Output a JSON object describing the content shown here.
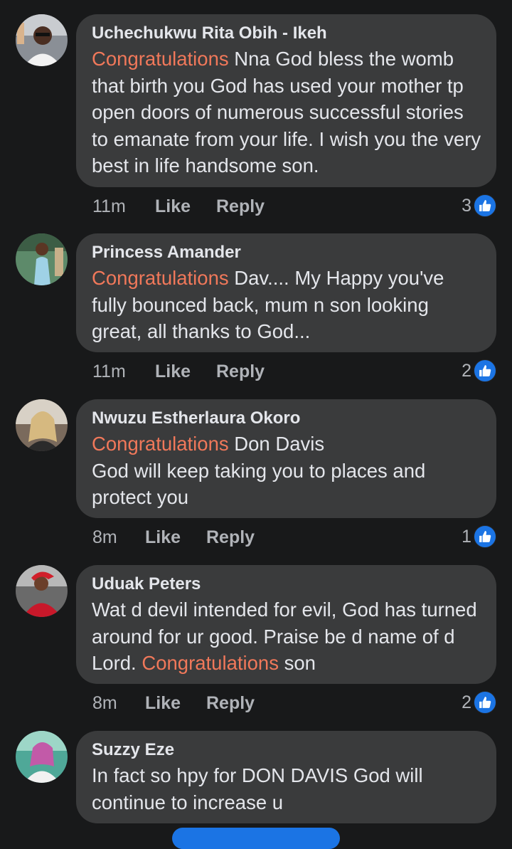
{
  "colors": {
    "background": "#18191a",
    "bubble": "#3a3b3c",
    "highlight": "#f0785a",
    "meta": "#b0b3b8",
    "reaction_blue": "#1b74e4"
  },
  "icons": {
    "reaction": "like-thumbs-up-icon"
  },
  "comments": [
    {
      "author": "Uchechukwu Rita Obih - Ikeh",
      "highlight": "Congratulations",
      "text": " Nna God bless the womb that birth you God has used your mother tp open doors of numerous successful stories to emanate from your life. I wish you the very best in life handsome son.",
      "time": "11m",
      "like_label": "Like",
      "reply_label": "Reply",
      "reactions": "3"
    },
    {
      "author": "Princess Amander",
      "highlight": "Congratulations",
      "text": " Dav.... My Happy you've fully bounced back, mum n son looking great, all thanks to God...",
      "time": "11m",
      "like_label": "Like",
      "reply_label": "Reply",
      "reactions": "2"
    },
    {
      "author": "Nwuzu Estherlaura Okoro",
      "highlight": "Congratulations",
      "text": " Don Davis\nGod will keep taking you to places and protect you",
      "time": "8m",
      "like_label": "Like",
      "reply_label": "Reply",
      "reactions": "1"
    },
    {
      "author": "Uduak Peters",
      "text_before": "Wat d devil intended for evil,  God has turned around for ur good. Praise be d name of d Lord. ",
      "highlight": "Congratulations",
      "text_after": " son",
      "time": "8m",
      "like_label": "Like",
      "reply_label": "Reply",
      "reactions": "2"
    },
    {
      "author": "Suzzy Eze",
      "text": "In fact so hpy for DON DAVIS God will continue to increase u"
    }
  ]
}
